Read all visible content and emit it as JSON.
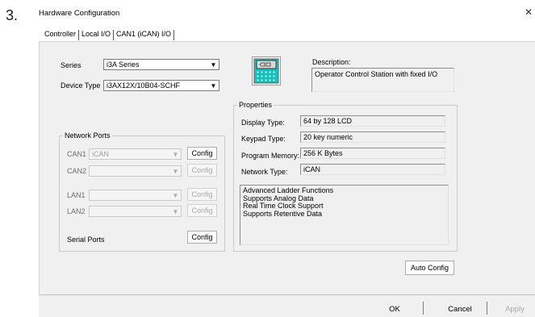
{
  "step_number": "3.",
  "window": {
    "title": "Hardware Configuration",
    "close_glyph": "✕"
  },
  "tabs": [
    {
      "label": "Controller"
    },
    {
      "label": "Local I/O"
    },
    {
      "label": "CAN1 (iCAN) I/O"
    }
  ],
  "series": {
    "label": "Series",
    "value": "i3A Series"
  },
  "device_type": {
    "label": "Device Type",
    "value": "i3AX12X/10B04-SCHF"
  },
  "device_icon": "controller-device-icon",
  "description": {
    "label": "Description:",
    "value": "Operator Control Station with fixed I/O"
  },
  "network_ports": {
    "title": "Network Ports",
    "can1": {
      "label": "CAN1",
      "value": "iCAN",
      "config": "Config"
    },
    "can2": {
      "label": "CAN2",
      "value": "",
      "config": "Config"
    },
    "lan1": {
      "label": "LAN1",
      "value": "",
      "config": "Config"
    },
    "lan2": {
      "label": "LAN2",
      "value": "",
      "config": "Config"
    },
    "serial": {
      "label": "Serial Ports",
      "config": "Config"
    }
  },
  "properties": {
    "title": "Properties",
    "display_type": {
      "label": "Display Type:",
      "value": "64 by 128 LCD"
    },
    "keypad_type": {
      "label": "Keypad Type:",
      "value": "20 key numeric"
    },
    "program_memory": {
      "label": "Program Memory:",
      "value": "256 K Bytes"
    },
    "network_type": {
      "label": "Network Type:",
      "value": "iCAN"
    },
    "features": [
      "Advanced Ladder Functions",
      "Supports Analog Data",
      "Real Time Clock Support",
      "Supports Retentive Data"
    ]
  },
  "auto_config_label": "Auto Config",
  "footer": {
    "ok": "OK",
    "cancel": "Cancel",
    "apply": "Apply"
  },
  "colors": {
    "panel_bg": "#f0f0f0",
    "icon_teal": "#19c7c0",
    "disabled_text": "#a8a8a8"
  }
}
